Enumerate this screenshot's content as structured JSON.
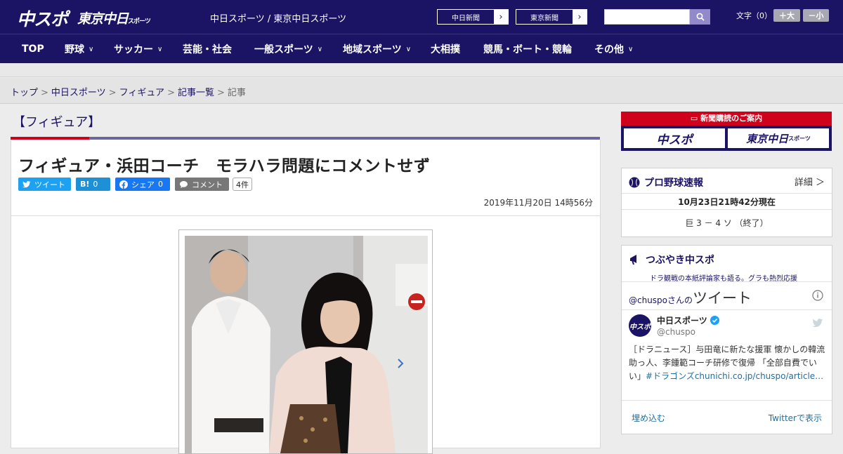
{
  "header": {
    "logo_primary": "中スポ",
    "logo_secondary": "東京中日",
    "logo_secondary_small": "スポーツ",
    "site_title": "中日スポーツ / 東京中日スポーツ",
    "ext_links": [
      {
        "label": "中日新聞"
      },
      {
        "label": "東京新聞"
      }
    ],
    "search": {
      "placeholder": "",
      "value": ""
    },
    "font_size_label": "文字（0）",
    "font_plus": "＋大",
    "font_minus": "－小"
  },
  "nav": {
    "items": [
      {
        "label": "TOP",
        "has_menu": false
      },
      {
        "label": "野球",
        "has_menu": true
      },
      {
        "label": "サッカー",
        "has_menu": true
      },
      {
        "label": "芸能・社会",
        "has_menu": false
      },
      {
        "label": "一般スポーツ",
        "has_menu": true
      },
      {
        "label": "地域スポーツ",
        "has_menu": true
      },
      {
        "label": "大相撲",
        "has_menu": false
      },
      {
        "label": "競馬・ボート・競輪",
        "has_menu": false
      },
      {
        "label": "その他",
        "has_menu": true
      }
    ]
  },
  "breadcrumb": [
    "トップ",
    "中日スポーツ",
    "フィギュア",
    "記事一覧",
    "記事"
  ],
  "article": {
    "category": "【フィギュア】",
    "headline": "フィギュア・浜田コーチ　モラハラ問題にコメントせず",
    "share": {
      "tweet": "ツイート",
      "hatena_label": "B!",
      "hatena_count": "0",
      "fb": "シェア",
      "fb_count": "0",
      "comment": "コメント",
      "comment_count": "4件"
    },
    "date": "2019年11月20日 14時56分"
  },
  "sidebar": {
    "subscribe": {
      "title": "新聞購読のご案内",
      "brand_a": "中スポ",
      "brand_b": "東京中日",
      "brand_b_small": "スポーツ"
    },
    "baseball": {
      "title": "プロ野球速報",
      "more": "詳細 ＞",
      "timestamp": "10月23日21時42分現在",
      "score": "巨 3 － 4 ソ （終了）"
    },
    "tsubuyaki": {
      "title": "つぶやき中スポ",
      "subtitle": "ドラ観戦の本紙評論家も語る。グラも熱烈応援",
      "tweets_prefix": "@chuspo",
      "tweets_suffix": "さんの",
      "tweets_big": "ツイート",
      "account_name": "中日スポーツ",
      "account_handle": "@chuspo",
      "avatar_text": "中スポ",
      "tweet_text": "［ドラニュース］与田竜に新たな援軍 懐かしの韓流助っ人、李鍾範コーチ研修で復帰 「全部自費でいい」",
      "tweet_link": "#ドラゴンズchunichi.co.jp/chuspo/article…",
      "embed": "埋め込む",
      "view_on_twitter": "Twitterで表示"
    }
  },
  "colors": {
    "navy": "#1b1464",
    "red": "#d0021b",
    "twitter": "#1da1f2",
    "hatena": "#1e90d6",
    "facebook": "#1877f2",
    "comment_gray": "#777777"
  }
}
